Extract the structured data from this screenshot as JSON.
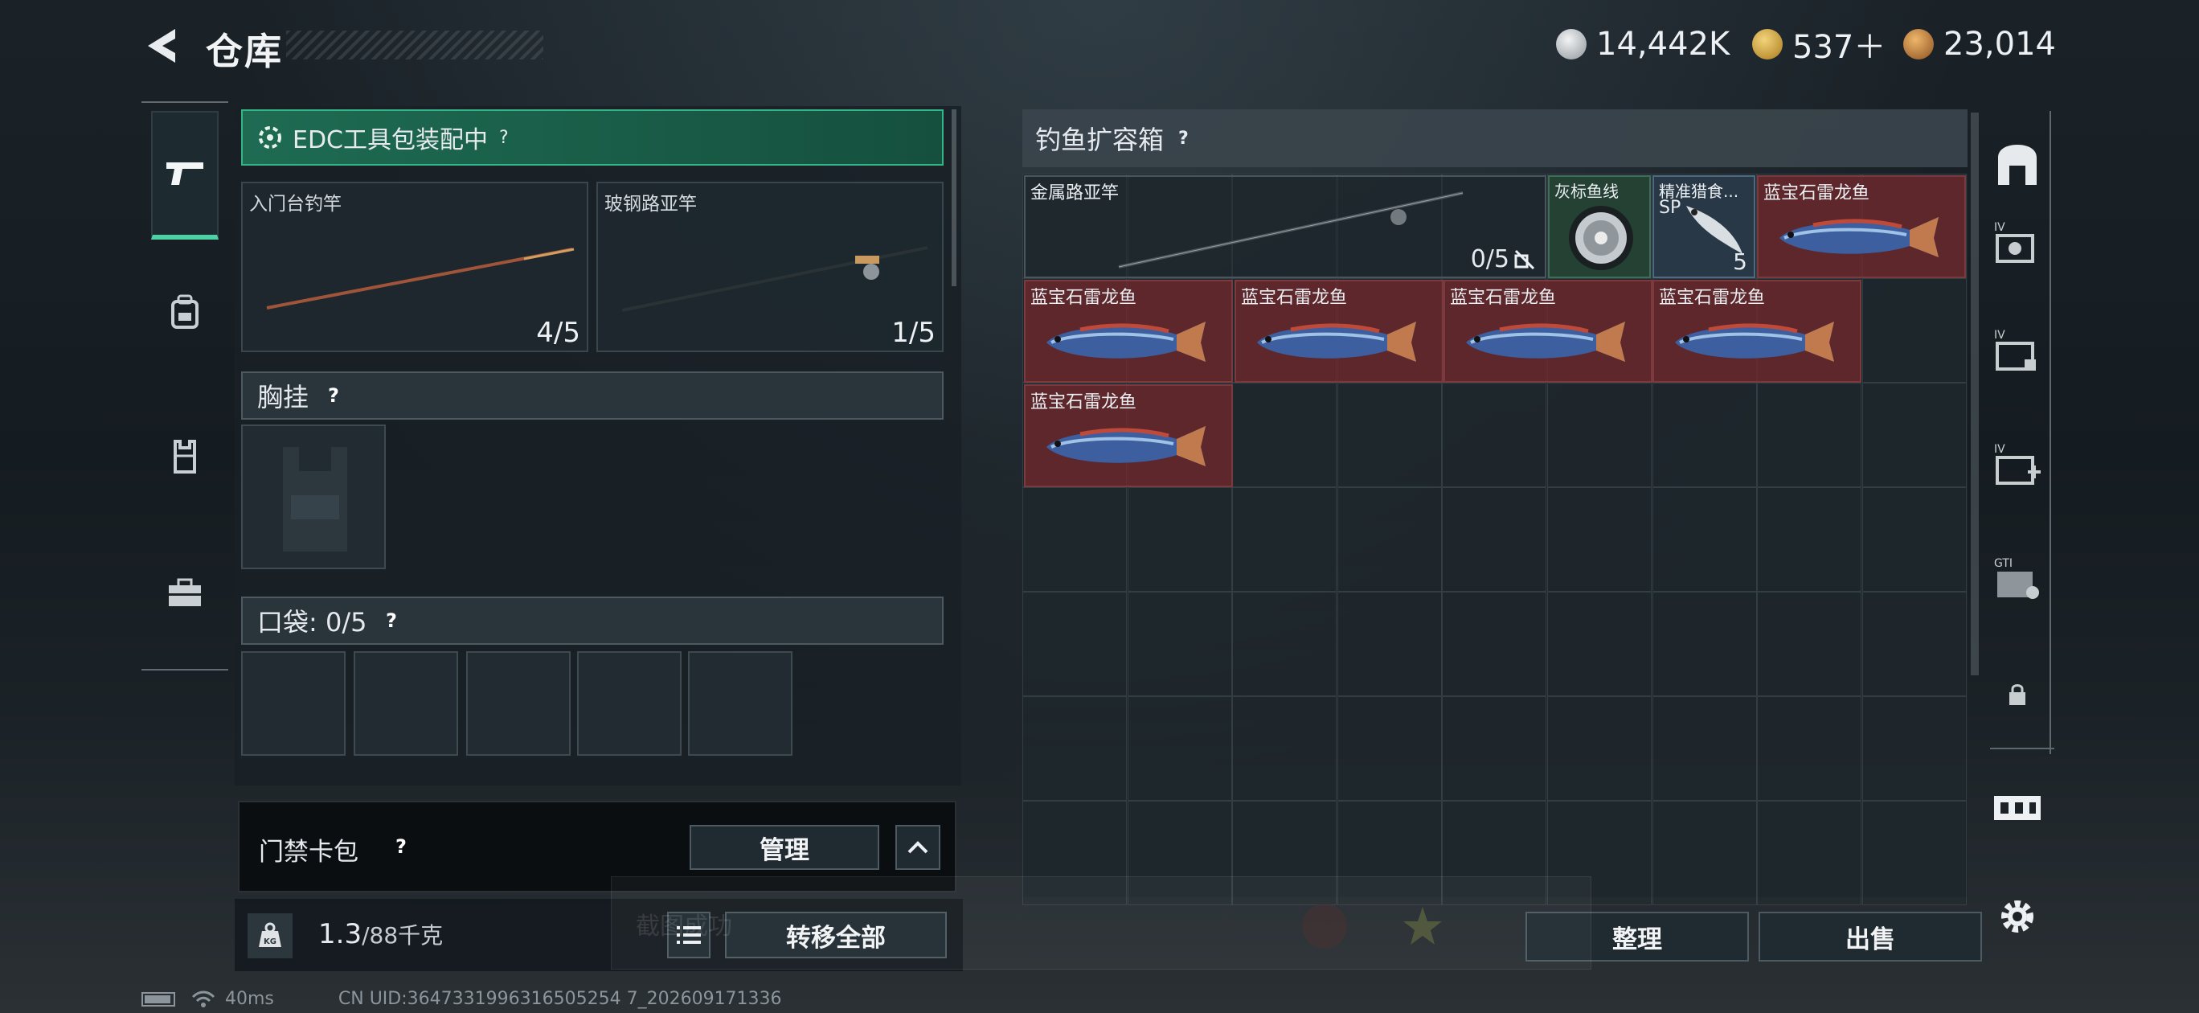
{
  "header": {
    "title": "仓库"
  },
  "currencies": [
    {
      "icon": "silver-coin-icon",
      "value": "14,442K",
      "color": "#c8ccd0"
    },
    {
      "icon": "gold-triangle-icon",
      "value": "537＋",
      "color": "#d4a63a"
    },
    {
      "icon": "bronze-coin-icon",
      "value": "23,014",
      "color": "#c98a3a"
    }
  ],
  "tabs": [
    {
      "icon": "pistol-icon",
      "active": true
    },
    {
      "icon": "backpack-icon",
      "active": false
    },
    {
      "icon": "vest-icon",
      "active": false
    },
    {
      "icon": "toolbox-icon",
      "active": false
    }
  ],
  "left": {
    "edc_label": "EDC工具包装配中",
    "slots": [
      {
        "label": "入门台钓竿",
        "count": "4/5"
      },
      {
        "label": "玻钢路亚竿",
        "count": "1/5"
      }
    ],
    "chest_label": "胸挂",
    "pocket_label": "口袋: 0/5",
    "keycase_label": "门禁卡包",
    "manage_label": "管理",
    "weight_value": "1.3",
    "weight_max": "/88千克",
    "transfer_all_label": "转移全部"
  },
  "right": {
    "container_title": "钓鱼扩容箱",
    "items": [
      {
        "label": "金属路亚竿",
        "count": "0/5",
        "kind": "rod"
      },
      {
        "label": "灰标鱼线",
        "kind": "line"
      },
      {
        "label": "精准猎食...",
        "sub": "SP",
        "count": "5",
        "kind": "lure"
      },
      {
        "label": "蓝宝石雷龙鱼",
        "kind": "fish"
      },
      {
        "label": "蓝宝石雷龙鱼",
        "kind": "fish"
      },
      {
        "label": "蓝宝石雷龙鱼",
        "kind": "fish"
      },
      {
        "label": "蓝宝石雷龙鱼",
        "kind": "fish"
      },
      {
        "label": "蓝宝石雷龙鱼",
        "kind": "fish"
      },
      {
        "label": "蓝宝石雷龙鱼",
        "kind": "fish"
      }
    ],
    "sort_label": "整理",
    "sell_label": "出售"
  },
  "side_tabs": [
    "IV",
    "IV",
    "IV",
    "GTI"
  ],
  "status": {
    "ping": "40ms",
    "uid": "CN UID:3647331996316505254 7_202609171336",
    "toast": "截图成功"
  }
}
